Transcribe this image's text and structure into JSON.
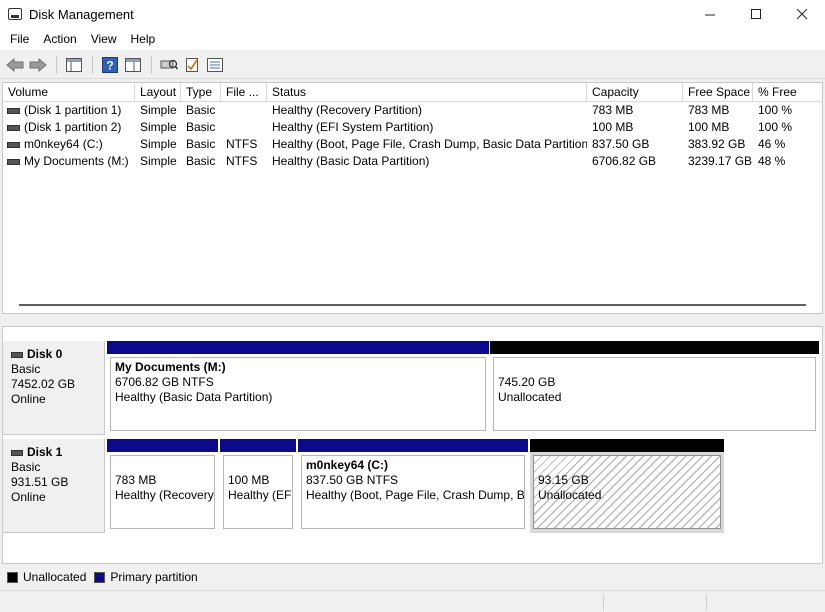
{
  "window": {
    "title": "Disk Management"
  },
  "menu": [
    "File",
    "Action",
    "View",
    "Help"
  ],
  "toolbar": [
    "back-icon",
    "forward-icon",
    "console-tree-icon",
    "help-icon",
    "properties-icon",
    "rescan-icon",
    "checklist-icon",
    "settings-icon"
  ],
  "volumes": {
    "columns": [
      "Volume",
      "Layout",
      "Type",
      "File ...",
      "Status",
      "Capacity",
      "Free Space",
      "% Free"
    ],
    "rows": [
      [
        "(Disk 1 partition 1)",
        "Simple",
        "Basic",
        "",
        "Healthy (Recovery Partition)",
        "783 MB",
        "783 MB",
        "100 %"
      ],
      [
        "(Disk 1 partition 2)",
        "Simple",
        "Basic",
        "",
        "Healthy (EFI System Partition)",
        "100 MB",
        "100 MB",
        "100 %"
      ],
      [
        "m0nkey64 (C:)",
        "Simple",
        "Basic",
        "NTFS",
        "Healthy (Boot, Page File, Crash Dump, Basic Data Partition)",
        "837.50 GB",
        "383.92 GB",
        "46 %"
      ],
      [
        "My Documents (M:)",
        "Simple",
        "Basic",
        "NTFS",
        "Healthy (Basic Data Partition)",
        "6706.82 GB",
        "3239.17 GB",
        "48 %"
      ]
    ]
  },
  "disks": [
    {
      "name": "Disk 0",
      "type": "Basic",
      "size": "7452.02 GB",
      "status": "Online",
      "partitions": [
        {
          "title": "My Documents  (M:)",
          "size": "6706.82 GB NTFS",
          "status": "Healthy (Basic Data Partition)",
          "kind": "primary"
        },
        {
          "title": "",
          "size": "745.20 GB",
          "status": "Unallocated",
          "kind": "unallocated"
        }
      ]
    },
    {
      "name": "Disk 1",
      "type": "Basic",
      "size": "931.51 GB",
      "status": "Online",
      "partitions": [
        {
          "title": "",
          "size": "783 MB",
          "status": "Healthy (Recovery",
          "kind": "primary"
        },
        {
          "title": "",
          "size": "100 MB",
          "status": "Healthy (EFI",
          "kind": "primary"
        },
        {
          "title": "m0nkey64  (C:)",
          "size": "837.50 GB NTFS",
          "status": "Healthy (Boot, Page File, Crash Dump, Ba",
          "kind": "primary"
        },
        {
          "title": "",
          "size": "93.15 GB",
          "status": "Unallocated",
          "kind": "unallocated",
          "selected": true
        }
      ]
    }
  ],
  "legend": [
    {
      "label": "Unallocated",
      "color": "#000000"
    },
    {
      "label": "Primary partition",
      "color": "#0a0a8a"
    }
  ]
}
